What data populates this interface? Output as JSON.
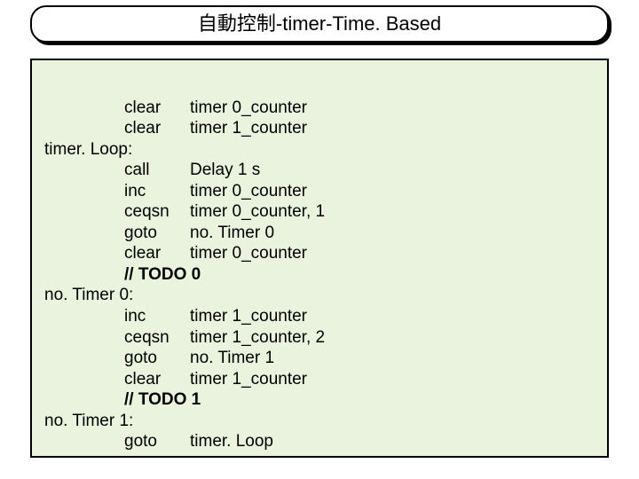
{
  "title": "自動控制-timer-Time. Based",
  "code": {
    "l1": {
      "op": "clear",
      "arg": "timer 0_counter"
    },
    "l2": {
      "op": "clear",
      "arg": "timer 1_counter"
    },
    "l3": {
      "label": "timer. Loop:"
    },
    "l4": {
      "op": "call",
      "arg": "Delay 1 s"
    },
    "l5": {
      "op": "inc",
      "arg": "timer 0_counter"
    },
    "l6": {
      "op": "ceqsn",
      "arg": "timer 0_counter, 1"
    },
    "l7": {
      "op": "goto",
      "arg": "no. Timer 0"
    },
    "l8": {
      "op": "clear",
      "arg": "timer 0_counter"
    },
    "l9": {
      "text": "// TODO 0"
    },
    "l10": {
      "label": "no. Timer 0:"
    },
    "l11": {
      "op": "inc",
      "arg": "timer 1_counter"
    },
    "l12": {
      "op": "ceqsn",
      "arg": "timer 1_counter, 2"
    },
    "l13": {
      "op": "goto",
      "arg": "no. Timer 1"
    },
    "l14": {
      "op": "clear",
      "arg": "timer 1_counter"
    },
    "l15": {
      "text": "// TODO 1"
    },
    "l16": {
      "label": "no. Timer 1:"
    },
    "l17": {
      "op": "goto",
      "arg": "timer. Loop"
    }
  }
}
